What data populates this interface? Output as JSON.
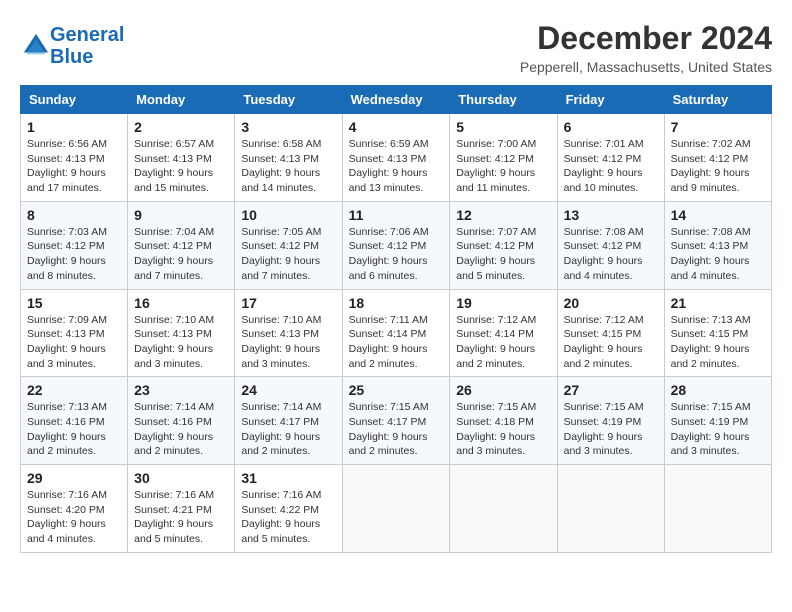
{
  "header": {
    "logo_line1": "General",
    "logo_line2": "Blue",
    "title": "December 2024",
    "subtitle": "Pepperell, Massachusetts, United States"
  },
  "weekdays": [
    "Sunday",
    "Monday",
    "Tuesday",
    "Wednesday",
    "Thursday",
    "Friday",
    "Saturday"
  ],
  "weeks": [
    [
      {
        "day": "1",
        "info": "Sunrise: 6:56 AM\nSunset: 4:13 PM\nDaylight: 9 hours and 17 minutes."
      },
      {
        "day": "2",
        "info": "Sunrise: 6:57 AM\nSunset: 4:13 PM\nDaylight: 9 hours and 15 minutes."
      },
      {
        "day": "3",
        "info": "Sunrise: 6:58 AM\nSunset: 4:13 PM\nDaylight: 9 hours and 14 minutes."
      },
      {
        "day": "4",
        "info": "Sunrise: 6:59 AM\nSunset: 4:13 PM\nDaylight: 9 hours and 13 minutes."
      },
      {
        "day": "5",
        "info": "Sunrise: 7:00 AM\nSunset: 4:12 PM\nDaylight: 9 hours and 11 minutes."
      },
      {
        "day": "6",
        "info": "Sunrise: 7:01 AM\nSunset: 4:12 PM\nDaylight: 9 hours and 10 minutes."
      },
      {
        "day": "7",
        "info": "Sunrise: 7:02 AM\nSunset: 4:12 PM\nDaylight: 9 hours and 9 minutes."
      }
    ],
    [
      {
        "day": "8",
        "info": "Sunrise: 7:03 AM\nSunset: 4:12 PM\nDaylight: 9 hours and 8 minutes."
      },
      {
        "day": "9",
        "info": "Sunrise: 7:04 AM\nSunset: 4:12 PM\nDaylight: 9 hours and 7 minutes."
      },
      {
        "day": "10",
        "info": "Sunrise: 7:05 AM\nSunset: 4:12 PM\nDaylight: 9 hours and 7 minutes."
      },
      {
        "day": "11",
        "info": "Sunrise: 7:06 AM\nSunset: 4:12 PM\nDaylight: 9 hours and 6 minutes."
      },
      {
        "day": "12",
        "info": "Sunrise: 7:07 AM\nSunset: 4:12 PM\nDaylight: 9 hours and 5 minutes."
      },
      {
        "day": "13",
        "info": "Sunrise: 7:08 AM\nSunset: 4:12 PM\nDaylight: 9 hours and 4 minutes."
      },
      {
        "day": "14",
        "info": "Sunrise: 7:08 AM\nSunset: 4:13 PM\nDaylight: 9 hours and 4 minutes."
      }
    ],
    [
      {
        "day": "15",
        "info": "Sunrise: 7:09 AM\nSunset: 4:13 PM\nDaylight: 9 hours and 3 minutes."
      },
      {
        "day": "16",
        "info": "Sunrise: 7:10 AM\nSunset: 4:13 PM\nDaylight: 9 hours and 3 minutes."
      },
      {
        "day": "17",
        "info": "Sunrise: 7:10 AM\nSunset: 4:13 PM\nDaylight: 9 hours and 3 minutes."
      },
      {
        "day": "18",
        "info": "Sunrise: 7:11 AM\nSunset: 4:14 PM\nDaylight: 9 hours and 2 minutes."
      },
      {
        "day": "19",
        "info": "Sunrise: 7:12 AM\nSunset: 4:14 PM\nDaylight: 9 hours and 2 minutes."
      },
      {
        "day": "20",
        "info": "Sunrise: 7:12 AM\nSunset: 4:15 PM\nDaylight: 9 hours and 2 minutes."
      },
      {
        "day": "21",
        "info": "Sunrise: 7:13 AM\nSunset: 4:15 PM\nDaylight: 9 hours and 2 minutes."
      }
    ],
    [
      {
        "day": "22",
        "info": "Sunrise: 7:13 AM\nSunset: 4:16 PM\nDaylight: 9 hours and 2 minutes."
      },
      {
        "day": "23",
        "info": "Sunrise: 7:14 AM\nSunset: 4:16 PM\nDaylight: 9 hours and 2 minutes."
      },
      {
        "day": "24",
        "info": "Sunrise: 7:14 AM\nSunset: 4:17 PM\nDaylight: 9 hours and 2 minutes."
      },
      {
        "day": "25",
        "info": "Sunrise: 7:15 AM\nSunset: 4:17 PM\nDaylight: 9 hours and 2 minutes."
      },
      {
        "day": "26",
        "info": "Sunrise: 7:15 AM\nSunset: 4:18 PM\nDaylight: 9 hours and 3 minutes."
      },
      {
        "day": "27",
        "info": "Sunrise: 7:15 AM\nSunset: 4:19 PM\nDaylight: 9 hours and 3 minutes."
      },
      {
        "day": "28",
        "info": "Sunrise: 7:15 AM\nSunset: 4:19 PM\nDaylight: 9 hours and 3 minutes."
      }
    ],
    [
      {
        "day": "29",
        "info": "Sunrise: 7:16 AM\nSunset: 4:20 PM\nDaylight: 9 hours and 4 minutes."
      },
      {
        "day": "30",
        "info": "Sunrise: 7:16 AM\nSunset: 4:21 PM\nDaylight: 9 hours and 5 minutes."
      },
      {
        "day": "31",
        "info": "Sunrise: 7:16 AM\nSunset: 4:22 PM\nDaylight: 9 hours and 5 minutes."
      },
      null,
      null,
      null,
      null
    ]
  ]
}
